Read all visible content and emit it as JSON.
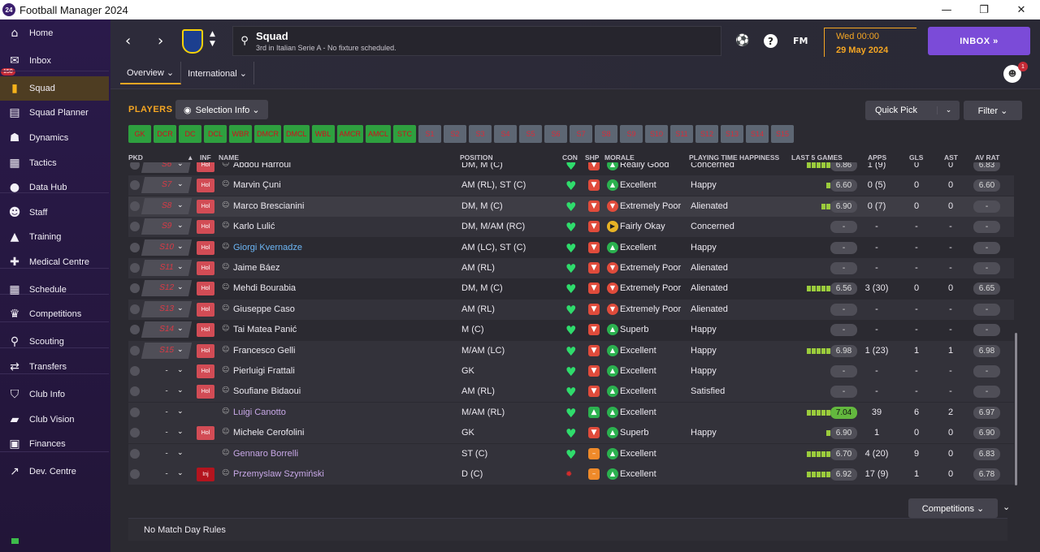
{
  "window": {
    "title": "Football Manager 2024",
    "app_icon_text": "24",
    "minimize": "—",
    "maximize": "❐",
    "close": "✕"
  },
  "sidebar": {
    "inbox_badge": "150",
    "items": [
      {
        "label": "Home",
        "icon": "⌂"
      },
      {
        "label": "Inbox",
        "icon": "✉"
      },
      {
        "label": "Squad",
        "icon": "▮"
      },
      {
        "label": "Squad Planner",
        "icon": "▤"
      },
      {
        "label": "Dynamics",
        "icon": "☗"
      },
      {
        "label": "Tactics",
        "icon": "▦"
      },
      {
        "label": "Data Hub",
        "icon": "●"
      },
      {
        "label": "Staff",
        "icon": "☻"
      },
      {
        "label": "Training",
        "icon": "▲"
      },
      {
        "label": "Medical Centre",
        "icon": "✚"
      },
      {
        "label": "Schedule",
        "icon": "▦"
      },
      {
        "label": "Competitions",
        "icon": "♛"
      },
      {
        "label": "Scouting",
        "icon": "⚲"
      },
      {
        "label": "Transfers",
        "icon": "⇄"
      },
      {
        "label": "Club Info",
        "icon": "⛉"
      },
      {
        "label": "Club Vision",
        "icon": "▰"
      },
      {
        "label": "Finances",
        "icon": "▣"
      },
      {
        "label": "Dev. Centre",
        "icon": "↗"
      }
    ]
  },
  "topbar": {
    "back": "‹",
    "forward": "›",
    "search_title": "Squad",
    "search_subtitle": "3rd in Italian Serie A - No fixture scheduled.",
    "fm_label": "FM",
    "help": "?",
    "date_time": "Wed 00:00",
    "date": "29 May 2024",
    "inbox_button": "INBOX  »",
    "avatar_badge": "1",
    "tabs": [
      {
        "label": "Overview ⌄"
      },
      {
        "label": "International ⌄"
      }
    ]
  },
  "panel": {
    "players_label": "PLAYERS",
    "selection_info": "Selection Info ⌄",
    "quick_pick": "Quick Pick",
    "quick_pick_caret": "⌄",
    "filter": "Filter ⌄",
    "position_filters_on": [
      "GK",
      "DCR",
      "DC",
      "DCL",
      "WBR",
      "DMCR",
      "DMCL",
      "WBL",
      "AMCR",
      "AMCL",
      "STC"
    ],
    "position_filters_off": [
      "S1",
      "S2",
      "S3",
      "S4",
      "S5",
      "S6",
      "S7",
      "S8",
      "S9",
      "S10",
      "S11",
      "S12",
      "S13",
      "S14",
      "S15"
    ]
  },
  "table": {
    "headers": {
      "pkd": "PKD",
      "inf": "INF",
      "name": "NAME",
      "position": "POSITION",
      "con": "CON",
      "shp": "SHP",
      "morale": "MORALE",
      "pth": "PLAYING TIME HAPPINESS",
      "last5": "LAST 5 GAMES",
      "apps": "APPS",
      "gls": "GLS",
      "ast": "AST",
      "avrat": "AV RAT"
    },
    "rows": [
      {
        "pkd": "S6",
        "inf": "Hol",
        "name": "Abdou Harroui",
        "pos": "DM, M (C)",
        "shp": "r",
        "mor": "g",
        "morale": "Really Good",
        "pth": "Concerned",
        "l5": 5,
        "avr5": "6.86",
        "apps": "1 (9)",
        "gls": "0",
        "ast": "0",
        "avr": "6.83"
      },
      {
        "pkd": "S7",
        "inf": "Hol",
        "name": "Marvin Çuni",
        "pos": "AM (RL), ST (C)",
        "shp": "r",
        "mor": "g",
        "morale": "Excellent",
        "pth": "Happy",
        "l5": 1,
        "avr5": "6.60",
        "apps": "0 (5)",
        "gls": "0",
        "ast": "0",
        "avr": "6.60"
      },
      {
        "pkd": "S8",
        "inf": "Hol",
        "name": "Marco Brescianini",
        "pos": "DM, M (C)",
        "shp": "r",
        "mor": "r",
        "morale": "Extremely Poor",
        "pth": "Alienated",
        "l5": 2,
        "avr5": "6.90",
        "apps": "0 (7)",
        "gls": "0",
        "ast": "0",
        "avr": "-"
      },
      {
        "pkd": "S9",
        "inf": "Hol",
        "name": "Karlo Lulić",
        "pos": "DM, M/AM (RC)",
        "shp": "r",
        "mor": "y",
        "morale": "Fairly Okay",
        "pth": "Concerned",
        "l5": 0,
        "avr5": "-",
        "apps": "-",
        "gls": "-",
        "ast": "-",
        "avr": "-"
      },
      {
        "pkd": "S10",
        "inf": "Hol",
        "name": "Giorgi Kvernadze",
        "nameStyle": "link",
        "pos": "AM (LC), ST (C)",
        "shp": "r",
        "mor": "g",
        "morale": "Excellent",
        "pth": "Happy",
        "l5": 0,
        "avr5": "-",
        "apps": "-",
        "gls": "-",
        "ast": "-",
        "avr": "-"
      },
      {
        "pkd": "S11",
        "inf": "Hol",
        "name": "Jaime Báez",
        "pos": "AM (RL)",
        "shp": "r",
        "mor": "r",
        "morale": "Extremely Poor",
        "pth": "Alienated",
        "l5": 0,
        "avr5": "-",
        "apps": "-",
        "gls": "-",
        "ast": "-",
        "avr": "-"
      },
      {
        "pkd": "S12",
        "inf": "Hol",
        "name": "Mehdi Bourabia",
        "pos": "DM, M (C)",
        "shp": "r",
        "mor": "r",
        "morale": "Extremely Poor",
        "pth": "Alienated",
        "l5": 5,
        "avr5": "6.56",
        "apps": "3 (30)",
        "gls": "0",
        "ast": "0",
        "avr": "6.65"
      },
      {
        "pkd": "S13",
        "inf": "Hol",
        "name": "Giuseppe Caso",
        "pos": "AM (RL)",
        "shp": "r",
        "mor": "r",
        "morale": "Extremely Poor",
        "pth": "Alienated",
        "l5": 0,
        "avr5": "-",
        "apps": "-",
        "gls": "-",
        "ast": "-",
        "avr": "-"
      },
      {
        "pkd": "S14",
        "inf": "Hol",
        "name": "Tai Matea Panić",
        "pos": "M (C)",
        "shp": "r",
        "mor": "g",
        "morale": "Superb",
        "pth": "Happy",
        "l5": 0,
        "avr5": "-",
        "apps": "-",
        "gls": "-",
        "ast": "-",
        "avr": "-"
      },
      {
        "pkd": "S15",
        "inf": "Hol",
        "name": "Francesco Gelli",
        "pos": "M/AM (LC)",
        "shp": "r",
        "mor": "g",
        "morale": "Excellent",
        "pth": "Happy",
        "l5": 5,
        "avr5": "6.98",
        "apps": "1 (23)",
        "gls": "1",
        "ast": "1",
        "avr": "6.98"
      },
      {
        "pkd": "-",
        "inf": "Hol",
        "name": "Pierluigi Frattali",
        "pos": "GK",
        "shp": "r",
        "mor": "g",
        "morale": "Excellent",
        "pth": "Happy",
        "l5": 0,
        "avr5": "-",
        "apps": "-",
        "gls": "-",
        "ast": "-",
        "avr": "-"
      },
      {
        "pkd": "-",
        "inf": "Hol",
        "name": "Soufiane Bidaoui",
        "pos": "AM (RL)",
        "shp": "r",
        "mor": "g",
        "morale": "Excellent",
        "pth": "Satisfied",
        "l5": 0,
        "avr5": "-",
        "apps": "-",
        "gls": "-",
        "ast": "-",
        "avr": "-"
      },
      {
        "pkd": "-",
        "inf": "",
        "name": "Luigi Canotto",
        "nameStyle": "loan",
        "pos": "M/AM (RL)",
        "shp": "g",
        "mor": "g",
        "morale": "Excellent",
        "pth": "",
        "l5": 5,
        "avr5": "7.04",
        "best": true,
        "apps": "39",
        "gls": "6",
        "ast": "2",
        "avr": "6.97"
      },
      {
        "pkd": "-",
        "inf": "Hol",
        "name": "Michele Cerofolini",
        "pos": "GK",
        "shp": "r",
        "mor": "g",
        "morale": "Superb",
        "pth": "Happy",
        "l5": 1,
        "avr5": "6.90",
        "apps": "1",
        "gls": "0",
        "ast": "0",
        "avr": "6.90"
      },
      {
        "pkd": "-",
        "inf": "",
        "name": "Gennaro Borrelli",
        "nameStyle": "loan",
        "pos": "ST (C)",
        "shp": "o",
        "mor": "g",
        "morale": "Excellent",
        "pth": "",
        "l5": 5,
        "avr5": "6.70",
        "apps": "4 (20)",
        "gls": "9",
        "ast": "0",
        "avr": "6.83"
      },
      {
        "pkd": "-",
        "inf": "Inj",
        "injured": true,
        "name": "Przemyslaw Szymiński",
        "nameStyle": "loan",
        "pos": "D (C)",
        "shp": "o",
        "mor": "g",
        "morale": "Excellent",
        "pth": "",
        "l5": 5,
        "avr5": "6.92",
        "apps": "17 (9)",
        "gls": "1",
        "ast": "0",
        "avr": "6.78"
      }
    ]
  },
  "footer": {
    "competitions": "Competitions ⌄",
    "competitions_caret": "⌄",
    "match_day_rules": "No Match Day Rules"
  },
  "colors": {
    "accent": "#f5a623",
    "inbox_button": "#7b4bd8",
    "sidebar": "#2a1a4a"
  }
}
